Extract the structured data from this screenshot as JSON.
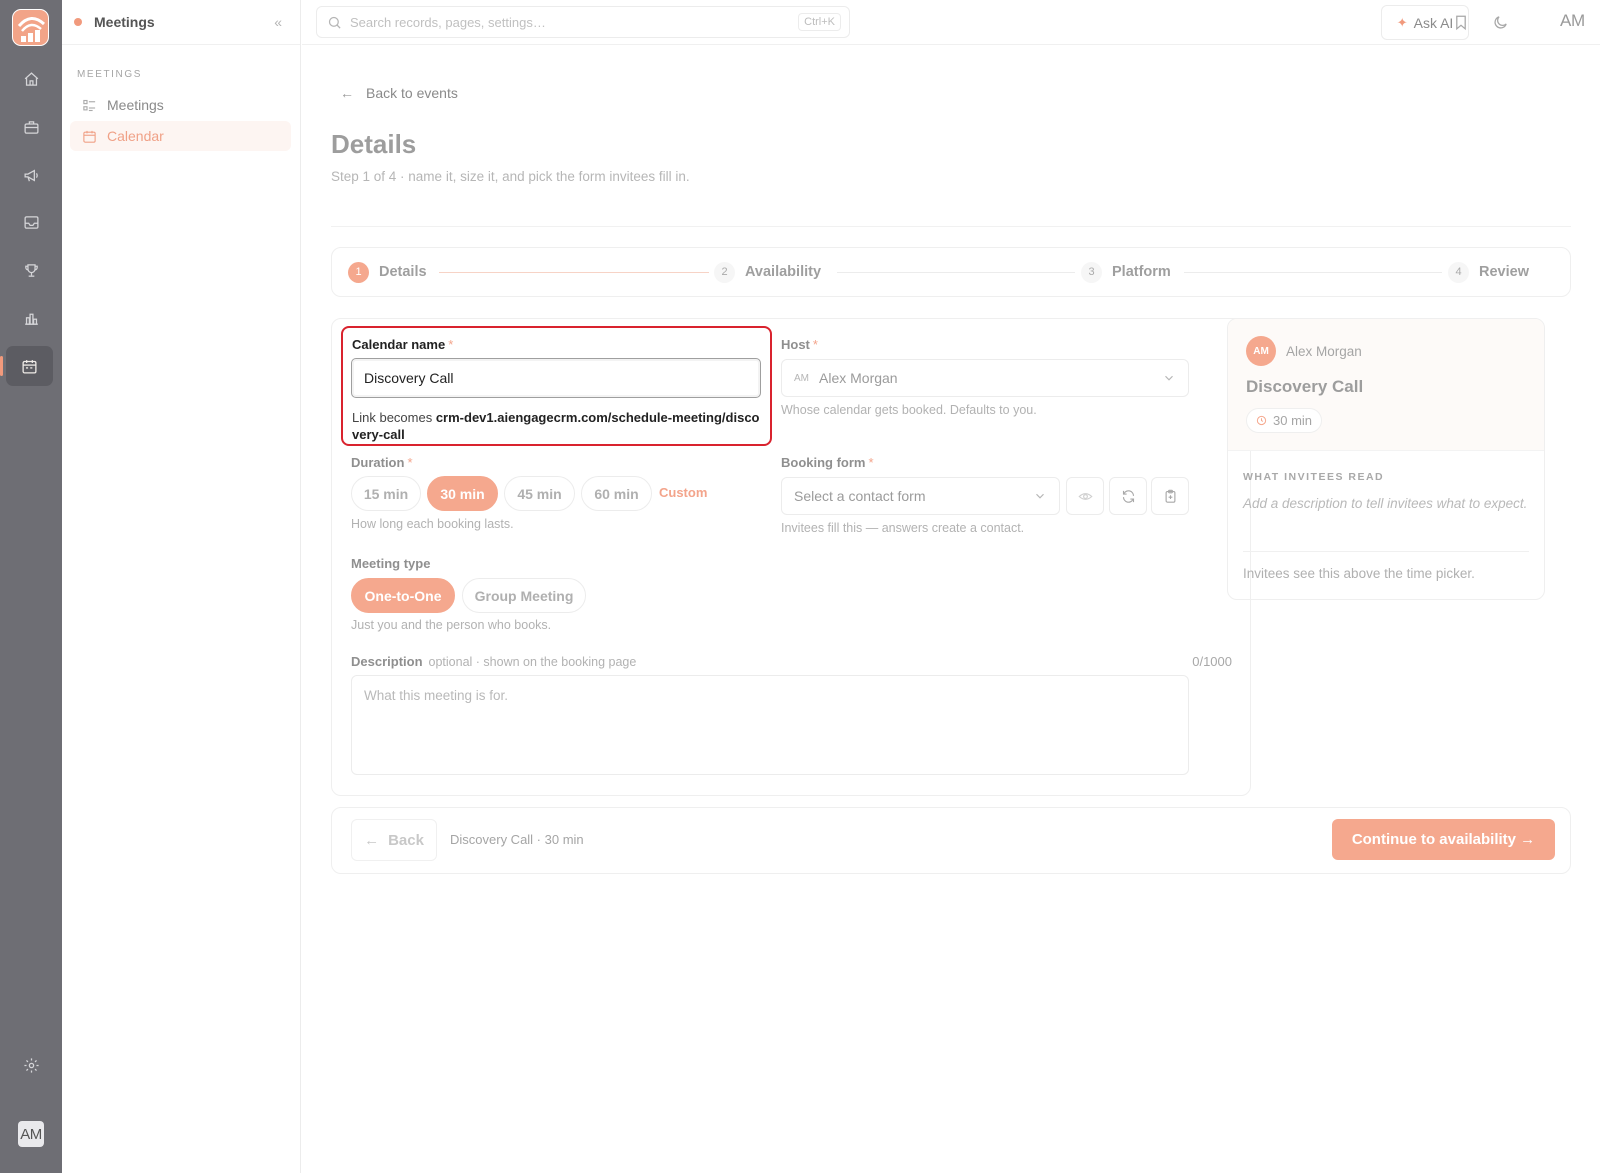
{
  "app": {
    "logo": "app-logo",
    "user_initials": "AM"
  },
  "rail": {
    "items": [
      {
        "icon": "home-icon"
      },
      {
        "icon": "briefcase-icon"
      },
      {
        "icon": "megaphone-icon"
      },
      {
        "icon": "inbox-icon"
      },
      {
        "icon": "trophy-icon"
      },
      {
        "icon": "bar-chart-icon"
      },
      {
        "icon": "calendar-icon",
        "active": true
      }
    ],
    "settings_icon": "gear-icon",
    "avatar": "AM"
  },
  "sidebar": {
    "title": "Meetings",
    "section": "MEETINGS",
    "items": [
      {
        "label": "Meetings",
        "icon": "list-icon",
        "active": false
      },
      {
        "label": "Calendar",
        "icon": "calendar-icon",
        "active": true
      }
    ]
  },
  "topbar": {
    "search_placeholder": "Search records, pages, settings…",
    "shortcut": "Ctrl+K",
    "ask_ai": "Ask AI",
    "user": "AM"
  },
  "page": {
    "back_link": "Back to events",
    "title": "Details",
    "subtitle": "Step 1 of 4 · name it, size it, and pick the form invitees fill in."
  },
  "stepper": [
    {
      "num": "1",
      "label": "Details",
      "active": true
    },
    {
      "num": "2",
      "label": "Availability",
      "active": false
    },
    {
      "num": "3",
      "label": "Platform",
      "active": false
    },
    {
      "num": "4",
      "label": "Review",
      "active": false
    }
  ],
  "form": {
    "calendar_name": {
      "label": "Calendar name",
      "required": "*",
      "value": "Discovery Call",
      "help_prefix": "Link becomes ",
      "help_link": "crm-dev1.aiengagecrm.com/schedule-meeting/discovery-call"
    },
    "host": {
      "label": "Host",
      "required": "*",
      "initials": "AM",
      "value": "Alex Morgan",
      "help": "Whose calendar gets booked. Defaults to you."
    },
    "duration": {
      "label": "Duration",
      "required": "*",
      "options": [
        "15 min",
        "30 min",
        "45 min",
        "60 min"
      ],
      "selected": "30 min",
      "custom": "Custom",
      "help": "How long each booking lasts."
    },
    "booking_form": {
      "label": "Booking form",
      "required": "*",
      "placeholder": "Select a contact form",
      "help": "Invitees fill this — answers create a contact."
    },
    "meeting_type": {
      "label": "Meeting type",
      "options": [
        "One-to-One",
        "Group Meeting"
      ],
      "selected": "One-to-One",
      "help": "Just you and the person who books."
    },
    "description": {
      "label": "Description",
      "optional": "optional · shown on the booking page",
      "counter": "0/1000",
      "placeholder": "What this meeting is for."
    }
  },
  "preview": {
    "avatar": "AM",
    "host": "Alex Morgan",
    "title": "Discovery Call",
    "duration": "30 min",
    "section": "WHAT INVITEES READ",
    "description_placeholder": "Add a description to tell invitees what to expect.",
    "footer": "Invitees see this above the time picker."
  },
  "footer": {
    "back": "Back",
    "summary": "Discovery Call · 30 min",
    "continue": "Continue to availability →"
  },
  "colors": {
    "accent": "#f5a88e",
    "highlight": "#d9232e",
    "rail": "#6e6e74"
  }
}
